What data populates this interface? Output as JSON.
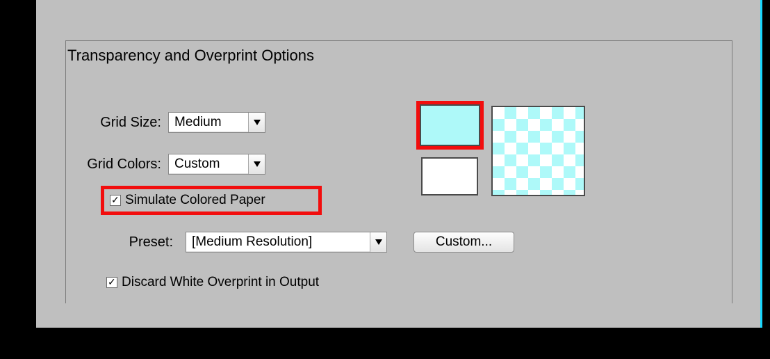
{
  "section": {
    "title": "Transparency and Overprint Options"
  },
  "gridSize": {
    "label": "Grid Size:",
    "value": "Medium"
  },
  "gridColors": {
    "label": "Grid Colors:",
    "value": "Custom"
  },
  "simulate": {
    "label": "Simulate Colored Paper",
    "checked": true
  },
  "preset": {
    "label": "Preset:",
    "value": "[Medium Resolution]",
    "customButton": "Custom..."
  },
  "discard": {
    "label": "Discard White Overprint in Output",
    "checked": true
  },
  "colors": {
    "swatchTop": "#aef9f9",
    "swatchBottom": "#ffffff",
    "checkerLight": "#ffffff",
    "checkerDark": "#aef9f9"
  }
}
